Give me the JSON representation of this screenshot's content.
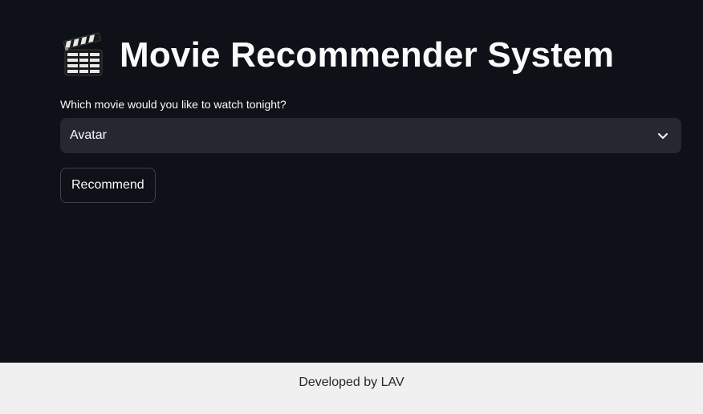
{
  "header": {
    "title": "Movie Recommender System",
    "icon": "clapper-board-icon"
  },
  "form": {
    "label": "Which movie would you like to watch tonight?",
    "selected_movie": "Avatar",
    "recommend_label": "Recommend"
  },
  "footer": {
    "text": "Developed by LAV"
  },
  "colors": {
    "background": "#0e1117",
    "select_background": "#262730",
    "text": "#fafafa",
    "footer_background": "#f0f0f0"
  }
}
